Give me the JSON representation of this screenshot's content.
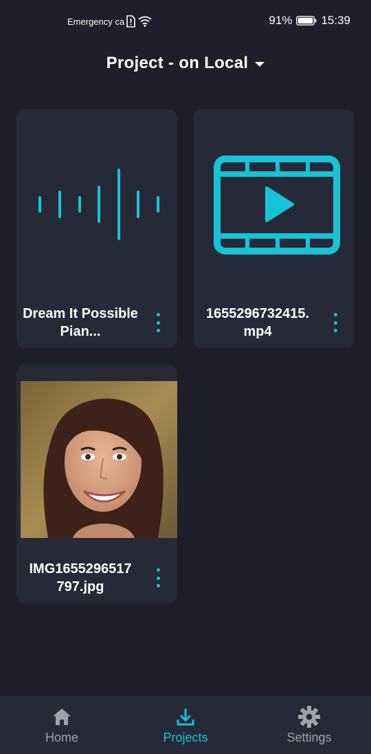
{
  "status_bar": {
    "carrier_text": "Emergency ca",
    "battery_percent": "91%",
    "time": "15:39"
  },
  "header": {
    "title": "Project - on Local"
  },
  "cards": [
    {
      "name": "Dream It Possible Pian...",
      "type_icon": "audio-waveform-icon"
    },
    {
      "name": "1655296732415.\nmp4",
      "type_icon": "video-film-icon"
    },
    {
      "name": "IMG1655296517\n797.jpg",
      "type_icon": "image-thumbnail"
    }
  ],
  "bottom_nav": {
    "items": [
      {
        "label": "Home",
        "icon": "home-icon"
      },
      {
        "label": "Projects",
        "icon": "download-icon",
        "active": true
      },
      {
        "label": "Settings",
        "icon": "gear-icon"
      }
    ]
  },
  "colors": {
    "accent": "#17c3d6",
    "background": "#1e1e2c",
    "card": "#262a38",
    "nav_inactive": "#a0a3ab"
  }
}
